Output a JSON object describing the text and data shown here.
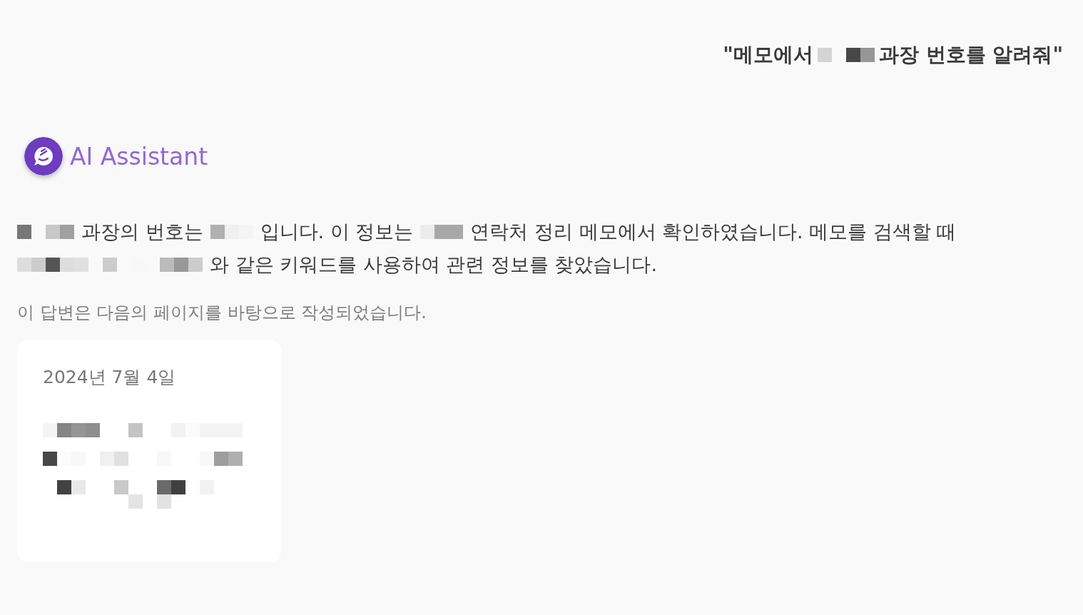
{
  "question": {
    "segments": [
      {
        "kind": "text",
        "text": "\"메모에서"
      },
      {
        "kind": "redacted"
      },
      {
        "kind": "text",
        "text": "과장 번호를 알려줘\""
      }
    ]
  },
  "assistant": {
    "name": "AI Assistant"
  },
  "answer": {
    "lines": [
      [
        {
          "kind": "redacted"
        },
        {
          "kind": "text",
          "text": "과장의 번호는"
        },
        {
          "kind": "redacted"
        },
        {
          "kind": "text",
          "text": "입니다. 이 정보는"
        },
        {
          "kind": "redacted"
        },
        {
          "kind": "text",
          "text": "연락처 정리 메모에서 확인하였습니다. 메모를 검색할 때"
        }
      ],
      [
        {
          "kind": "redacted"
        },
        {
          "kind": "text",
          "text": "와 같은 키워드를 사용하여 관련 정보를 찾았습니다."
        }
      ]
    ]
  },
  "sources": {
    "caption": "이 답변은 다음의 페이지를 바탕으로 작성되었습니다.",
    "cards": [
      {
        "date": "2024년 7월 4일",
        "body": {
          "kind": "redacted"
        }
      }
    ]
  }
}
